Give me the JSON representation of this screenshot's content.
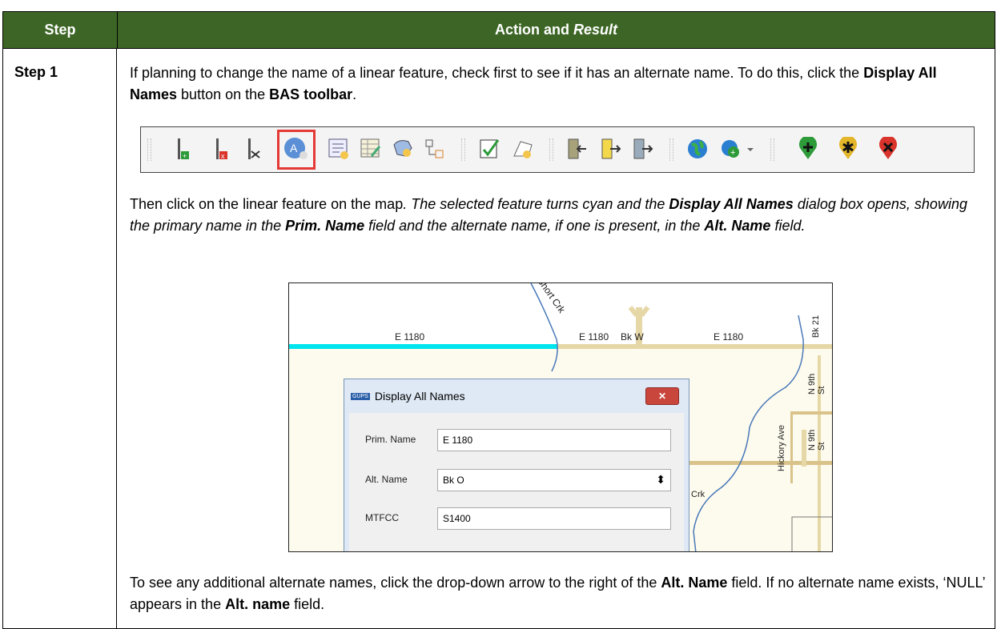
{
  "table": {
    "header_step": "Step",
    "header_action_prefix": "Action and ",
    "header_action_result": "Result",
    "step_label": "Step 1"
  },
  "para1": {
    "t1": "If planning to change the name of a linear feature, check first to see if it has an alternate name. To do this, click the ",
    "b1": "Display All Names",
    "t2": " button on the ",
    "b2": "BAS toolbar",
    "t3": "."
  },
  "para2": {
    "t1": "Then click on the linear feature on the map",
    "i1": ". The selected feature turns cyan and the ",
    "bi1": "Display All Names",
    "i2": " dialog box opens, showing the primary name in the ",
    "bi2": "Prim. Name",
    "i3": " field and the alternate name, if one is present, in the ",
    "bi3": "Alt. Name",
    "i4": " field."
  },
  "para3": {
    "t1": "To see any additional alternate names, click the drop-down arrow to the right of the ",
    "b1": "Alt. Name",
    "t2": " field. If no alternate name exists, ‘NULL’ appears in the ",
    "b2": "Alt. name",
    "t3": " field."
  },
  "toolbar": {
    "icons": [
      "add-line-icon",
      "delete-line-icon",
      "split-line-icon",
      "display-all-names-icon",
      "attribute-form-icon",
      "table-edit-icon",
      "identify-icon",
      "feature-tree-icon",
      "validate-icon",
      "polygon-edit-icon",
      "import-icon",
      "export-icon",
      "review-icon",
      "globe-icon",
      "add-layer-icon",
      "add-marker-icon",
      "asterisk-marker-icon",
      "remove-marker-icon"
    ]
  },
  "map": {
    "labels": {
      "short_crk": "Short Crk",
      "e1180_a": "E 1180",
      "e1180_b": "E 1180",
      "bk_w": "Bk W",
      "e1180_c": "E 1180",
      "bk21": "Bk 21",
      "n9th_a": "N 9th St",
      "n9th_b": "N 9th St",
      "hickory": "Hickory Ave",
      "crk": "Crk"
    }
  },
  "dialog": {
    "title": "Display All Names",
    "app_badge": "GUPS",
    "close": "✕",
    "prim_label": "Prim. Name",
    "prim_value": "E 1180",
    "alt_label": "Alt. Name",
    "alt_value": "Bk O",
    "mtfcc_label": "MTFCC",
    "mtfcc_value": "S1400",
    "spinner": "⬍"
  },
  "colors": {
    "header_bg": "#3d6626",
    "cyan": "#00e5ee",
    "road": "#e6d7a6",
    "water": "#4a79b8"
  }
}
